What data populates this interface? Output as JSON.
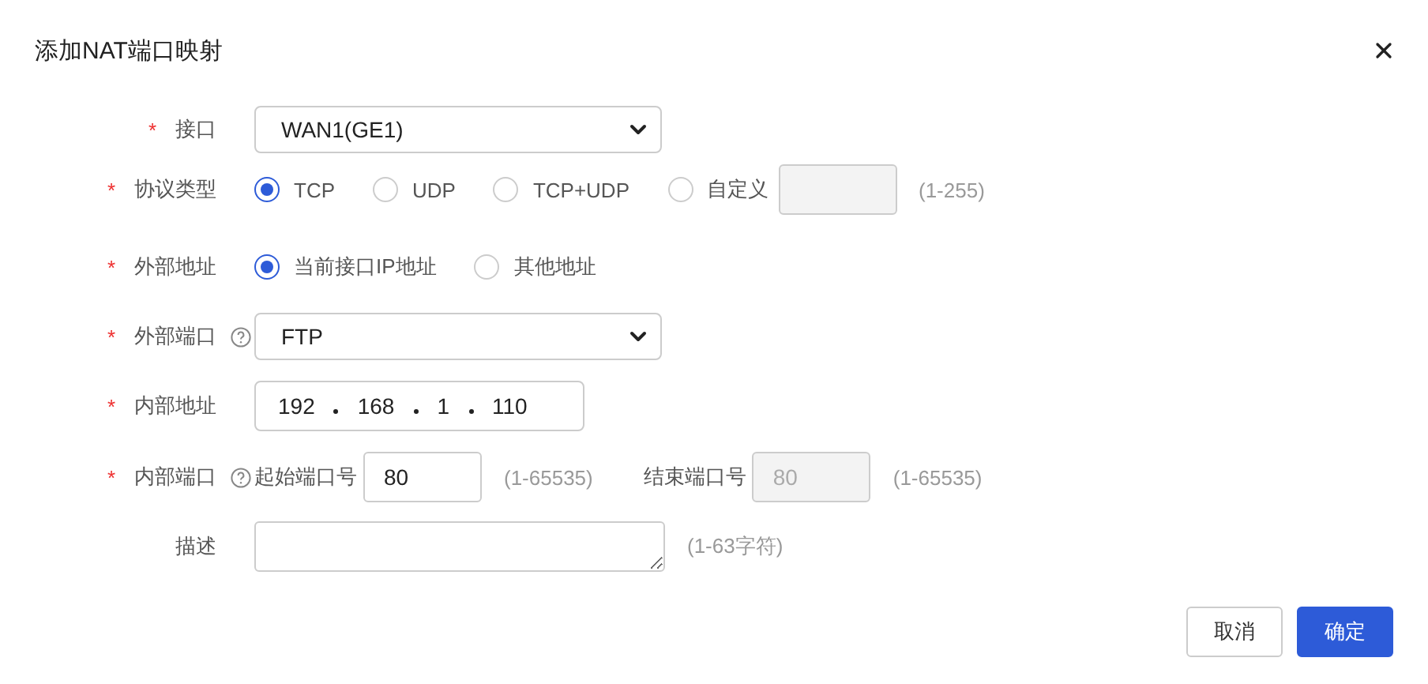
{
  "dialog": {
    "title": "添加NAT端口映射"
  },
  "rows": [
    {
      "kind": "select",
      "required_mark": "*",
      "label": "接口",
      "help": false,
      "value": "WAN1(GE1)"
    },
    {
      "kind": "radio",
      "required_mark": "*",
      "label": "协议类型",
      "help": false,
      "options": [
        {
          "label": "TCP",
          "selected": true
        },
        {
          "label": "UDP",
          "selected": false
        },
        {
          "label": "TCP+UDP",
          "selected": false
        },
        {
          "label": "自定义",
          "selected": false
        }
      ],
      "custom_input": {
        "disabled": true
      },
      "hint": "(1-255)"
    },
    {
      "kind": "radio",
      "required_mark": "*",
      "label": "外部地址",
      "help": false,
      "options": [
        {
          "label": "当前接口IP地址",
          "selected": true
        },
        {
          "label": "其他地址",
          "selected": false
        }
      ]
    },
    {
      "kind": "select",
      "required_mark": "*",
      "label": "外部端口",
      "help": true,
      "value": "FTP"
    },
    {
      "kind": "ip",
      "required_mark": "*",
      "label": "内部地址",
      "help": false,
      "octets": [
        "192",
        "168",
        "1",
        "110"
      ]
    },
    {
      "kind": "range",
      "required_mark": "*",
      "label": "内部端口",
      "help": true,
      "start": {
        "label": "起始端口号",
        "value": "80",
        "disabled": false,
        "hint": "(1-65535)"
      },
      "end": {
        "label": "结束端口号",
        "value": "80",
        "disabled": true,
        "hint": "(1-65535)"
      }
    },
    {
      "kind": "textarea",
      "label": "描述",
      "help": false,
      "hint": "(1-63字符)"
    }
  ],
  "buttons": [
    {
      "label": "取消",
      "primary": false
    },
    {
      "label": "确定",
      "primary": true
    }
  ]
}
